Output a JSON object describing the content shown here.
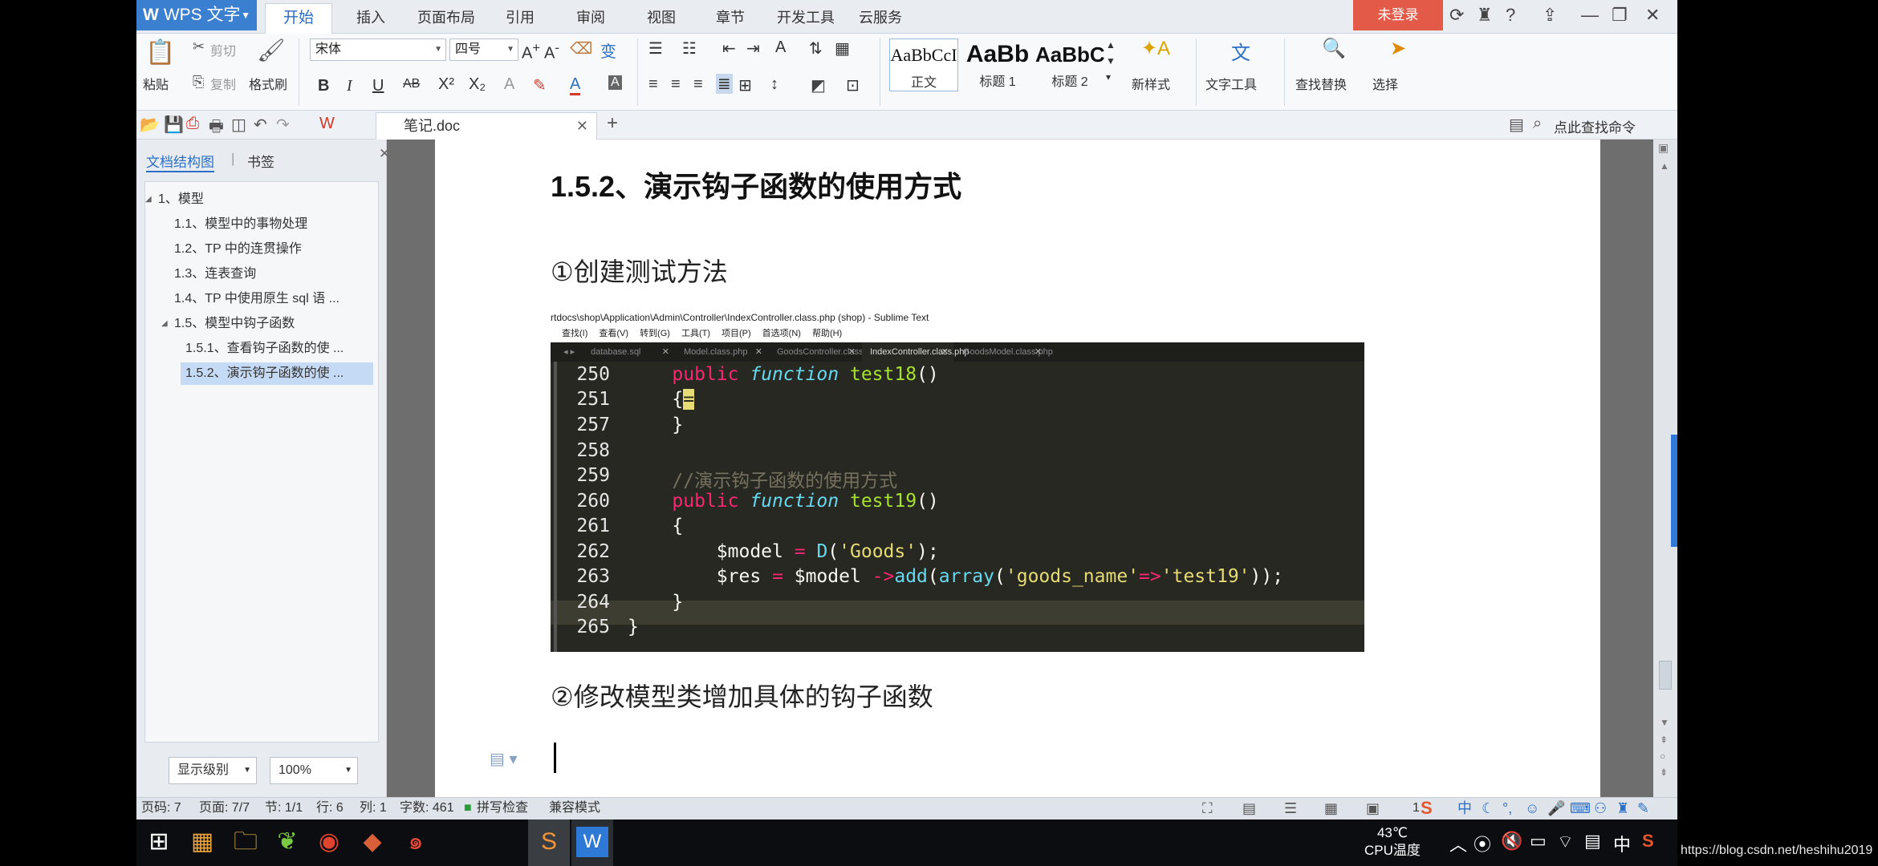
{
  "app": {
    "name": "WPS 文字",
    "login": "未登录"
  },
  "menu": [
    "开始",
    "插入",
    "页面布局",
    "引用",
    "审阅",
    "视图",
    "章节",
    "开发工具",
    "云服务"
  ],
  "ribbon": {
    "paste": "粘贴",
    "cut": "剪切",
    "copy": "复制",
    "format_painter": "格式刷",
    "font": "宋体",
    "size": "四号",
    "styles": [
      {
        "sample": "AaBbCcI",
        "name": "正文"
      },
      {
        "sample": "AaBb",
        "name": "标题 1"
      },
      {
        "sample": "AaBbC",
        "name": "标题 2"
      }
    ],
    "new_style": "新样式",
    "text_tools": "文字工具",
    "find_replace": "查找替换",
    "select": "选择"
  },
  "quickbar": {
    "doc_tab": "笔记.doc",
    "search_cmd": "点此查找命令"
  },
  "sidebar": {
    "tabs": [
      "文档结构图",
      "书签"
    ],
    "outline": [
      {
        "text": "1、模型",
        "level": 0,
        "selected": false
      },
      {
        "text": "1.1、模型中的事物处理",
        "level": 1,
        "selected": false
      },
      {
        "text": "1.2、TP 中的连贯操作",
        "level": 1,
        "selected": false
      },
      {
        "text": "1.3、连表查询",
        "level": 1,
        "selected": false
      },
      {
        "text": "1.4、TP 中使用原生 sql 语 ...",
        "level": 1,
        "selected": false
      },
      {
        "text": "1.5、模型中钩子函数",
        "level": 1,
        "selected": false
      },
      {
        "text": "1.5.1、查看钩子函数的使 ...",
        "level": 2,
        "selected": false
      },
      {
        "text": "1.5.2、演示钩子函数的使 ...",
        "level": 2,
        "selected": true
      }
    ],
    "level_combo": "显示级别",
    "zoom_combo": "100%"
  },
  "document": {
    "heading": "1.5.2、演示钩子函数的使用方式",
    "step1": "①创建测试方法",
    "step2": "②修改模型类增加具体的钩子函数"
  },
  "sublime": {
    "title": "rtdocs\\shop\\Application\\Admin\\Controller\\IndexController.class.php (shop) - Sublime Text",
    "menu": [
      "查找(I)",
      "查看(V)",
      "转到(G)",
      "工具(T)",
      "项目(P)",
      "首选项(N)",
      "帮助(H)"
    ],
    "tabs": [
      "database.sql",
      "Model.class.php",
      "GoodsController.class.php",
      "IndexController.class.php",
      "GoodsModel.class.php"
    ],
    "active_tab": 3,
    "line_numbers": [
      "250",
      "251",
      "257",
      "258",
      "259",
      "260",
      "261",
      "262",
      "263",
      "264",
      "265"
    ]
  },
  "statusbar": {
    "page_no": "页码: 7",
    "pages": "页面: 7/7",
    "section": "节: 1/1",
    "row": "行: 6",
    "col": "列: 1",
    "words": "字数: 461",
    "spell": "拼写检查",
    "compat": "兼容模式",
    "right_num": "1"
  },
  "taskbar": {
    "cpu_temp": "43℃",
    "cpu_label": "CPU温度",
    "ime": "中"
  },
  "watermark": "https://blog.csdn.net/heshihu2019"
}
